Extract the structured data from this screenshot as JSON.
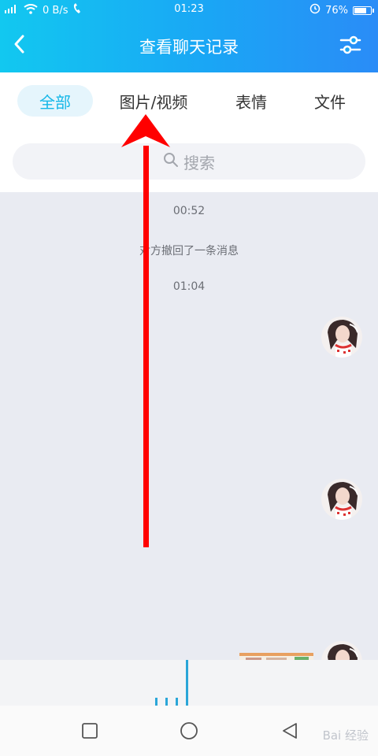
{
  "status_bar": {
    "network": "0 B/s",
    "time": "01:23",
    "battery": "76%",
    "battery_level": 0.76
  },
  "header": {
    "title": "查看聊天记录"
  },
  "tabs": [
    {
      "label": "全部",
      "active": true
    },
    {
      "label": "图片/视频",
      "active": false
    },
    {
      "label": "表情",
      "active": false
    },
    {
      "label": "文件",
      "active": false
    }
  ],
  "search": {
    "placeholder": "搜索"
  },
  "chat": {
    "items": [
      {
        "type": "time",
        "text": "00:52"
      },
      {
        "type": "notice",
        "text": "对方撤回了一条消息"
      },
      {
        "type": "time",
        "text": "01:04"
      }
    ]
  },
  "watermark": "Bai 经验",
  "colors": {
    "accent": "#14b7e8",
    "header_start": "#12c8f0",
    "header_end": "#2a8cf7",
    "arrow": "#f00"
  }
}
